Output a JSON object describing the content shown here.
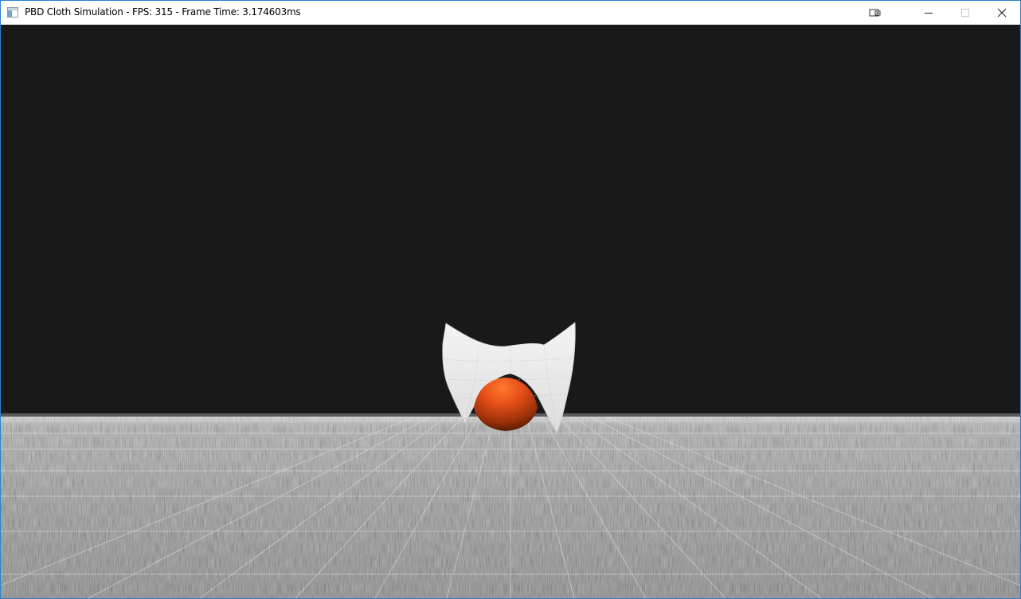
{
  "window": {
    "title": "PBD Cloth Simulation - FPS: 315 - Frame Time: 3.174603ms",
    "icon": "application-window-icon",
    "controls": [
      "capture-icon",
      "minimize-icon",
      "maximize-icon",
      "close-icon"
    ]
  },
  "scene": {
    "background_color": "#191919",
    "floor_color": "#8c8c8c",
    "cloth_color": "#e9e9e9",
    "sphere_color": "#e8501a"
  }
}
